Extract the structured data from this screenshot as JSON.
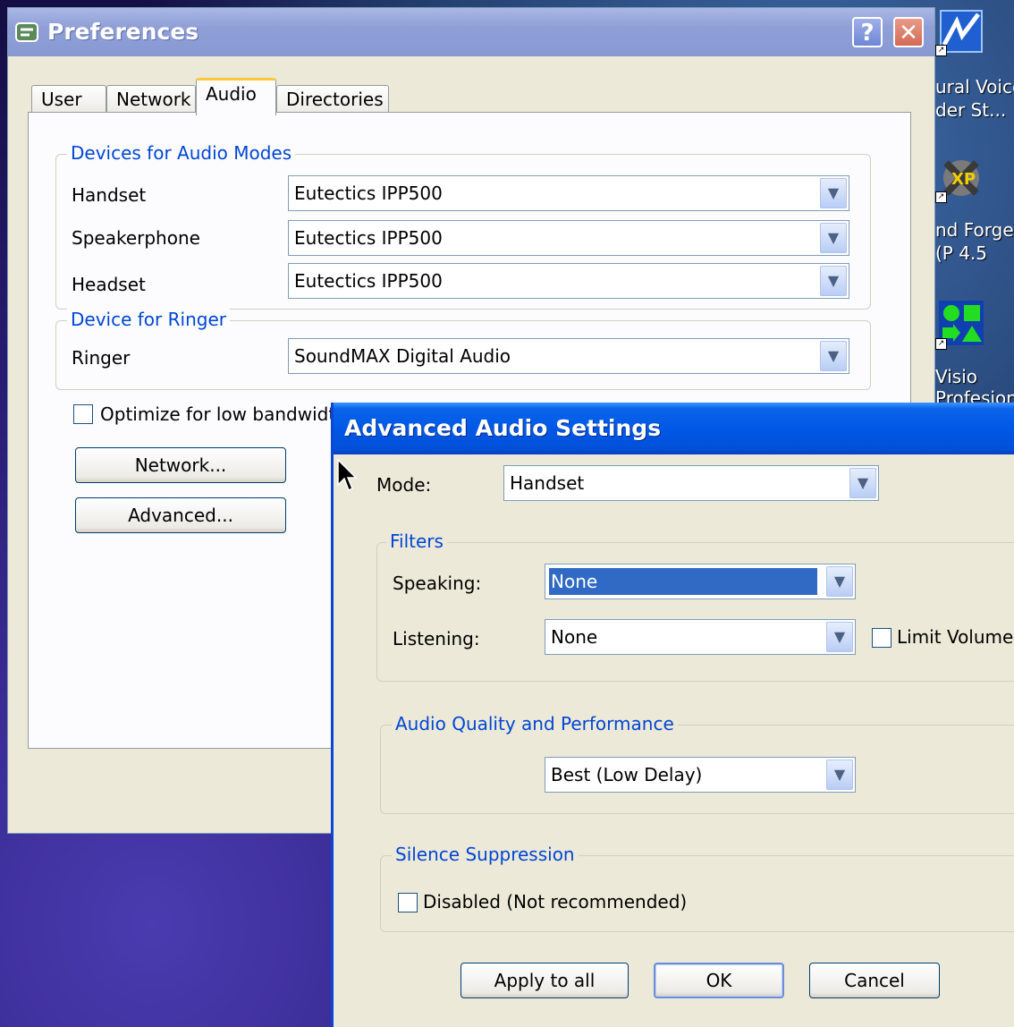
{
  "desktop": {
    "icons": [
      {
        "label1": "ural Voice",
        "label2": "der St...",
        "icon": "lightning-app-icon"
      },
      {
        "label1": "nd Forge",
        "label2": "(P 4.5",
        "icon": "xp-app-icon"
      },
      {
        "label1": "Visio",
        "label2": "Profesional",
        "icon": "visio-icon"
      }
    ]
  },
  "preferences": {
    "title": "Preferences",
    "help_label": "?",
    "close_label": "✕",
    "tabs": [
      {
        "label": "User"
      },
      {
        "label": "Network"
      },
      {
        "label": "Audio",
        "active": true
      },
      {
        "label": "Directories"
      }
    ],
    "devices_group": {
      "legend": "Devices for Audio Modes",
      "rows": [
        {
          "label": "Handset",
          "value": "Eutectics IPP500"
        },
        {
          "label": "Speakerphone",
          "value": "Eutectics IPP500"
        },
        {
          "label": "Headset",
          "value": "Eutectics IPP500"
        }
      ]
    },
    "ringer_group": {
      "legend": "Device for Ringer",
      "label": "Ringer",
      "value": "SoundMAX Digital Audio"
    },
    "optimize_label": "Optimize for low bandwidth",
    "optimize_checked": false,
    "network_button": "Network...",
    "advanced_button": "Advanced..."
  },
  "advanced": {
    "title": "Advanced Audio Settings",
    "mode_label": "Mode:",
    "mode_value": "Handset",
    "filters": {
      "legend": "Filters",
      "speaking_label": "Speaking:",
      "speaking_value": "None",
      "listening_label": "Listening:",
      "listening_value": "None",
      "limit_volume_label": "Limit Volume",
      "limit_volume_checked": false
    },
    "quality": {
      "legend": "Audio Quality and Performance",
      "value": "Best (Low Delay)"
    },
    "silence": {
      "legend": "Silence Suppression",
      "disabled_label": "Disabled (Not recommended)",
      "disabled_checked": false
    },
    "buttons": {
      "apply_all": "Apply to all",
      "ok": "OK",
      "cancel": "Cancel"
    }
  },
  "colors": {
    "xp_blue_title": "#0058e6",
    "legend_blue": "#0046d5",
    "selection": "#316ac5",
    "tab_highlight": "#ffc83c"
  }
}
